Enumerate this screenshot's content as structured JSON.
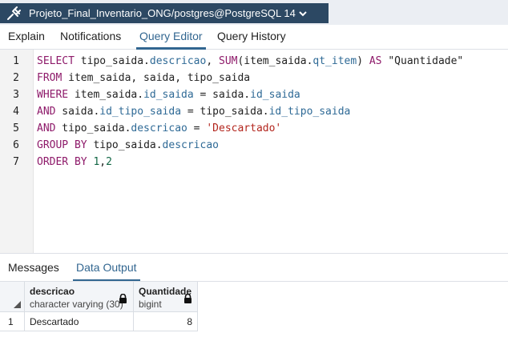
{
  "connection": {
    "title": "Projeto_Final_Inventario_ONG/postgres@PostgreSQL 14",
    "icon": "plug-icon",
    "dropdown_icon": "chevron-down-icon"
  },
  "tabs": {
    "explain": "Explain",
    "notifications": "Notifications",
    "query_editor": "Query Editor",
    "query_history": "Query History",
    "active": "Query Editor"
  },
  "editor": {
    "line_numbers": [
      "1",
      "2",
      "3",
      "4",
      "5",
      "6",
      "7"
    ],
    "lines": [
      [
        {
          "t": "kw",
          "v": "SELECT"
        },
        {
          "t": "p",
          "v": " tipo_saida."
        },
        {
          "t": "prop",
          "v": "descricao"
        },
        {
          "t": "p",
          "v": ", "
        },
        {
          "t": "fn",
          "v": "SUM"
        },
        {
          "t": "p",
          "v": "(item_saida."
        },
        {
          "t": "prop",
          "v": "qt_item"
        },
        {
          "t": "p",
          "v": ") "
        },
        {
          "t": "kw",
          "v": "AS"
        },
        {
          "t": "p",
          "v": " \"Quantidade\""
        }
      ],
      [
        {
          "t": "kw",
          "v": "FROM"
        },
        {
          "t": "p",
          "v": " item_saida, saida, tipo_saida"
        }
      ],
      [
        {
          "t": "kw",
          "v": "WHERE"
        },
        {
          "t": "p",
          "v": " item_saida."
        },
        {
          "t": "prop",
          "v": "id_saida"
        },
        {
          "t": "p",
          "v": " = saida."
        },
        {
          "t": "prop",
          "v": "id_saida"
        }
      ],
      [
        {
          "t": "kw",
          "v": "AND"
        },
        {
          "t": "p",
          "v": " saida."
        },
        {
          "t": "prop",
          "v": "id_tipo_saida"
        },
        {
          "t": "p",
          "v": " = tipo_saida."
        },
        {
          "t": "prop",
          "v": "id_tipo_saida"
        }
      ],
      [
        {
          "t": "kw",
          "v": "AND"
        },
        {
          "t": "p",
          "v": " tipo_saida."
        },
        {
          "t": "prop",
          "v": "descricao"
        },
        {
          "t": "p",
          "v": " = "
        },
        {
          "t": "str",
          "v": "'Descartado'"
        }
      ],
      [
        {
          "t": "kw",
          "v": "GROUP BY"
        },
        {
          "t": "p",
          "v": " tipo_saida."
        },
        {
          "t": "prop",
          "v": "descricao"
        }
      ],
      [
        {
          "t": "kw",
          "v": "ORDER BY"
        },
        {
          "t": "p",
          "v": " "
        },
        {
          "t": "num",
          "v": "1"
        },
        {
          "t": "p",
          "v": ","
        },
        {
          "t": "num",
          "v": "2"
        }
      ]
    ]
  },
  "bottom_tabs": {
    "messages": "Messages",
    "data_output": "Data Output",
    "active": "Data Output"
  },
  "results": {
    "columns": [
      {
        "name": "descricao",
        "type": "character varying (30)",
        "locked": true
      },
      {
        "name": "Quantidade",
        "type": "bigint",
        "locked": true
      }
    ],
    "rows": [
      {
        "num": "1",
        "cells": [
          "Descartado",
          "8"
        ]
      }
    ]
  },
  "colors": {
    "connection_bar": "#2c4863",
    "accent": "#326690",
    "keyword": "#8e1a6a",
    "property": "#2f6a96",
    "string": "#b3261e",
    "number": "#116644"
  }
}
